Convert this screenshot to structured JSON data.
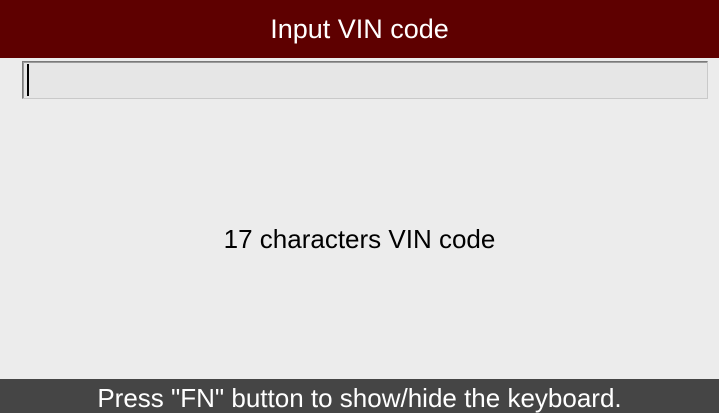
{
  "header": {
    "title": "Input VIN code"
  },
  "vin_input": {
    "value": "",
    "placeholder": ""
  },
  "main": {
    "hint": "17 characters VIN code"
  },
  "footer": {
    "instruction": "Press \"FN\" button to show/hide the keyboard."
  },
  "colors": {
    "title_bar": "#5e0000",
    "footer_bar": "#454545",
    "background": "#ececec"
  }
}
